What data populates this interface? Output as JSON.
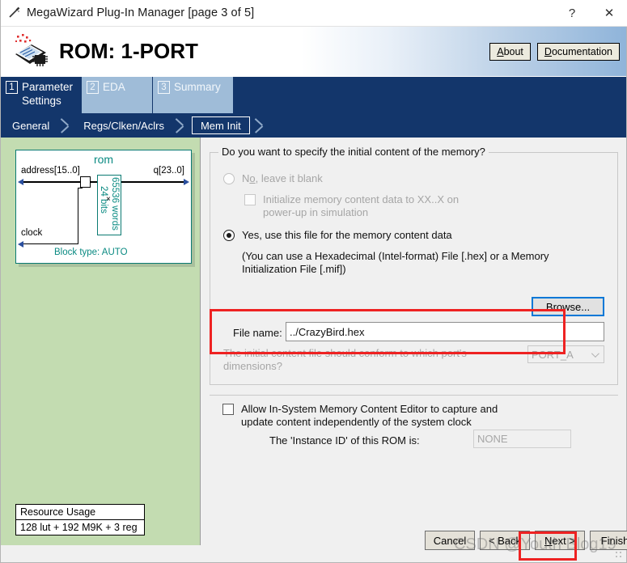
{
  "window": {
    "title": "MegaWizard Plug-In Manager [page 3 of 5]",
    "icon": "magic-wand-icon",
    "help_glyph": "?",
    "close_glyph": "✕"
  },
  "header": {
    "title": "ROM: 1-PORT",
    "icon": "megawizard-chip-icon",
    "buttons": [
      {
        "label_pre": "",
        "mnemonic": "A",
        "label_post": "bout",
        "name": "about-button"
      },
      {
        "label_pre": "",
        "mnemonic": "D",
        "label_post": "ocumentation",
        "name": "documentation-button"
      }
    ]
  },
  "tabs": [
    {
      "num": "1",
      "label": "Parameter Settings",
      "active": true
    },
    {
      "num": "2",
      "label": "EDA",
      "active": false
    },
    {
      "num": "3",
      "label": "Summary",
      "active": false
    }
  ],
  "subtabs": [
    {
      "label": "General",
      "selected": false
    },
    {
      "label": "Regs/Clken/Aclrs",
      "selected": false
    },
    {
      "label": "Mem Init",
      "selected": true
    }
  ],
  "symbol": {
    "name": "rom",
    "input_address": "address[15..0]",
    "input_clock": "clock",
    "output_q": "q[23..0]",
    "mem_bits": "24 bits",
    "mem_words": "65536 words",
    "block_type": "Block type: AUTO"
  },
  "resource_usage": {
    "title": "Resource Usage",
    "value": "128 lut + 192 M9K + 3 reg"
  },
  "form": {
    "group_title": "Do you want to specify the initial content of the memory?",
    "option_no_pre": "N",
    "option_no_mnemonic": "o",
    "option_no_post": ", leave it blank",
    "checkbox_init_line1": "Initialize memory content data to XX..X on",
    "checkbox_init_line2": "power-up in simulation",
    "option_yes": "Yes, use this file for the memory content data",
    "hint_line1": "(You can use a Hexadecimal (Intel-format) File [.hex] or a Memory",
    "hint_line2": "Initialization File [.mif])",
    "browse_label": "Browse...",
    "file_name_label": "File name:",
    "file_name_value": "../CrazyBird.hex",
    "port_question_line1": "The initial content file should conform to which port's",
    "port_question_line2": "dimensions?",
    "port_selected": "PORT_A",
    "allow_ismce_line1": "Allow In-System Memory Content Editor to capture and",
    "allow_ismce_line2": "update content independently of the system clock",
    "instance_id_label": "The 'Instance ID' of this ROM is:",
    "instance_id_value": "NONE"
  },
  "footer": {
    "cancel": "Cancel",
    "back": "< Back",
    "next_pre": "",
    "next_mnemonic": "N",
    "next_post": "ext >",
    "finish": "Finish"
  },
  "watermark": {
    "text": "CSDN @Youth Blog19"
  },
  "colors": {
    "tab_active": "#13366b",
    "tab_inactive": "#9fbcd8",
    "panel_green": "#c3dcb1",
    "symbol_teal": "#0a8a82",
    "annotation_red": "#ee2222",
    "focus_blue": "#0078d7"
  }
}
